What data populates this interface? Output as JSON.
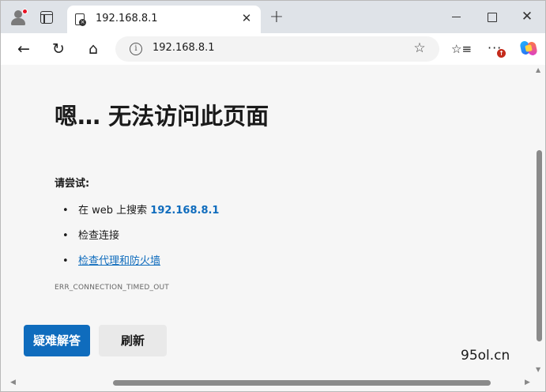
{
  "tab": {
    "title": "192.168.8.1",
    "close": "✕"
  },
  "window_controls": {
    "close": "✕"
  },
  "toolbar": {
    "back": "←",
    "refresh": "↻",
    "home": "⌂",
    "info": "i",
    "url": "192.168.8.1",
    "favorite": "☆",
    "favorites_list": "☆≡",
    "more": "···",
    "update_badge": "↑",
    "new_tab": "+"
  },
  "error": {
    "headline": "嗯… 无法访问此页面",
    "try_label": "请尝试:",
    "suggestions": {
      "search_prefix": "在 web 上搜索",
      "search_link": "192.168.8.1",
      "check_connection": "检查连接",
      "check_proxy": "检查代理和防火墙"
    },
    "bullet": "•",
    "code": "ERR_CONNECTION_TIMED_OUT"
  },
  "buttons": {
    "troubleshoot": "疑难解答",
    "refresh": "刷新"
  },
  "watermark": "95ol.cn",
  "scroll_arrows": {
    "up": "▲",
    "down": "▼",
    "left": "◀",
    "right": "▶"
  }
}
